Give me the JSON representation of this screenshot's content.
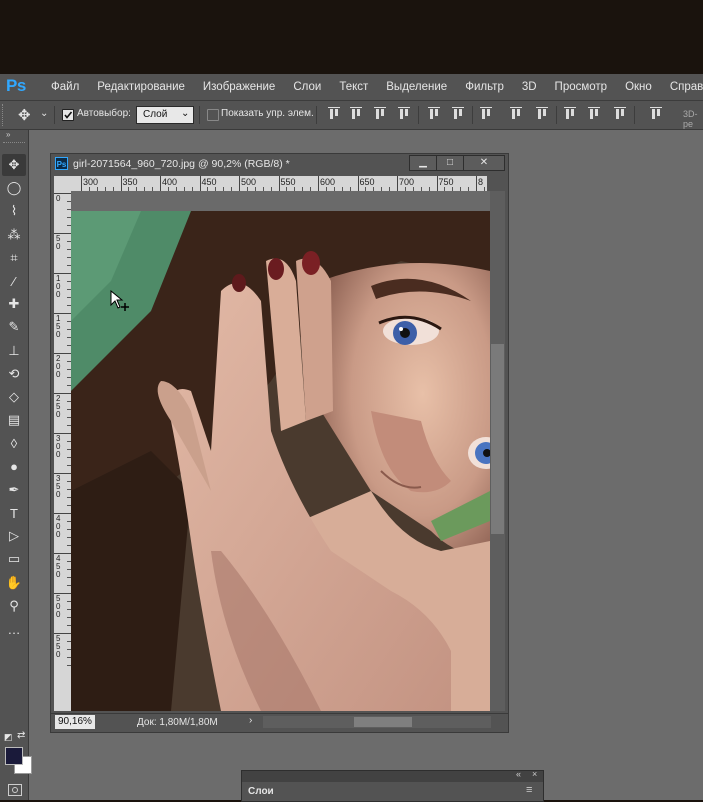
{
  "app": {
    "logo": "Ps"
  },
  "menu": [
    "Файл",
    "Редактирование",
    "Изображение",
    "Слои",
    "Текст",
    "Выделение",
    "Фильтр",
    "3D",
    "Просмотр",
    "Окно",
    "Справка"
  ],
  "options": {
    "autoselect_label": "Автовыбор:",
    "autoselect_checked": true,
    "select_value": "Слой",
    "show_controls_label": "Показать упр. элем.",
    "show_controls_checked": false,
    "mode3d_label": "3D-ре"
  },
  "tools": [
    "move-tool",
    "marquee-tool",
    "lasso-tool",
    "quick-select-tool",
    "crop-tool",
    "eyedropper-tool",
    "spot-heal-tool",
    "brush-tool",
    "clone-stamp-tool",
    "history-brush-tool",
    "eraser-tool",
    "gradient-tool",
    "blur-tool",
    "dodge-tool",
    "pen-tool",
    "type-tool",
    "path-select-tool",
    "shape-tool",
    "hand-tool",
    "zoom-tool",
    "more-tools"
  ],
  "tool_glyphs": [
    "✥",
    "◯",
    "⌇",
    "⁂",
    "⌗",
    "⁄",
    "✚",
    "✎",
    "⊥",
    "⟲",
    "◇",
    "▤",
    "◊",
    "●",
    "✒",
    "T",
    "▷",
    "▭",
    "✋",
    "⚲",
    "…"
  ],
  "colors": {
    "foreground": "#1a1a3a",
    "background": "#ffffff",
    "accent": "#31a8ff"
  },
  "document": {
    "title": "girl-2071564_960_720.jpg @ 90,2% (RGB/8) *",
    "zoom": "90,16%",
    "doc_info": "Док: 1,80M/1,80M",
    "ruler_h": [
      "300",
      "350",
      "400",
      "450",
      "500",
      "550",
      "600",
      "650",
      "700",
      "750",
      "8"
    ],
    "ruler_v": [
      "0",
      "5 0",
      "1 0 0",
      "1 5 0",
      "2 0 0",
      "2 5 0",
      "3 0 0",
      "3 5 0",
      "4 0 0",
      "4 5 0",
      "5 0 0",
      "5 5 0"
    ]
  },
  "layers_panel": {
    "tab": "Слои"
  }
}
